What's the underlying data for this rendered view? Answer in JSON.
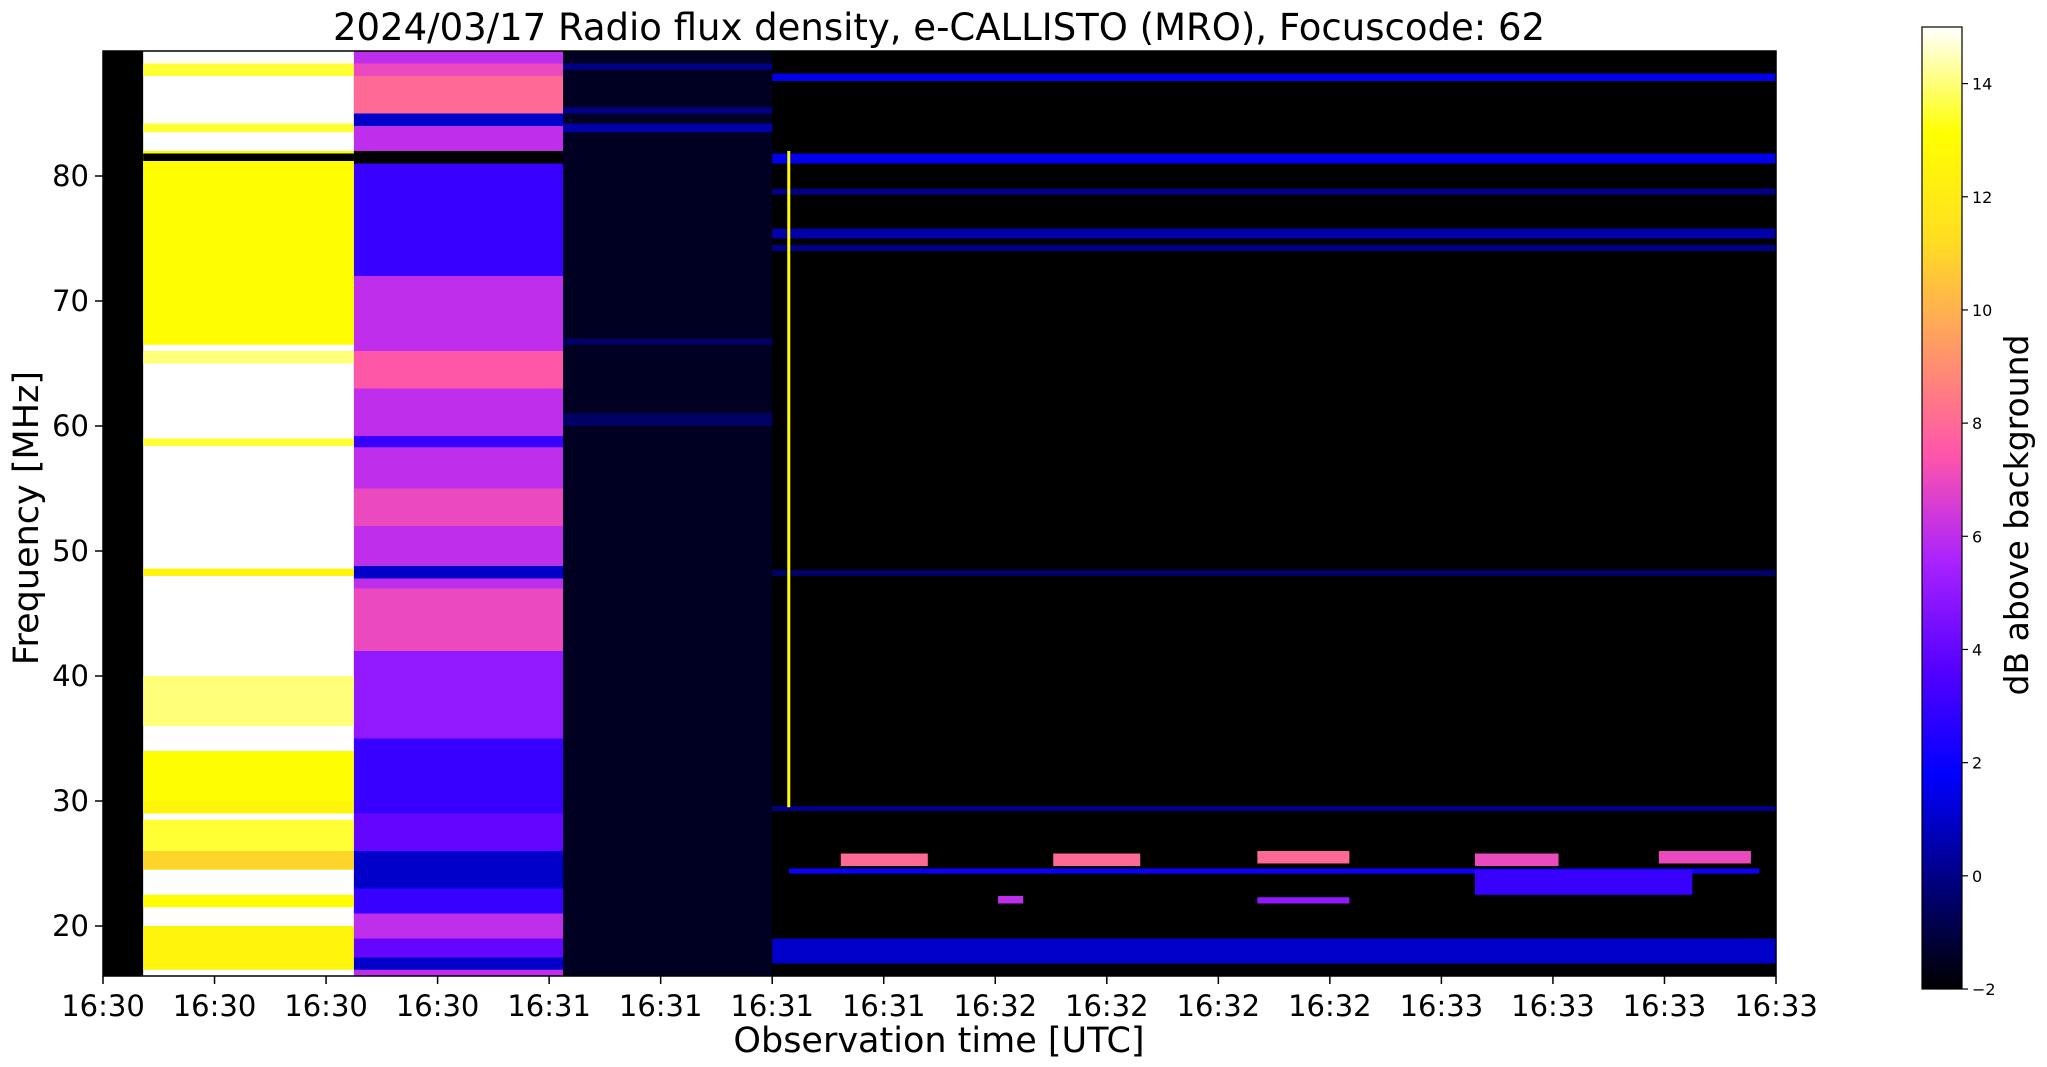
{
  "chart_data": {
    "type": "heatmap",
    "title": "2024/03/17  Radio flux density, e-CALLISTO (MRO), Focuscode: 62",
    "xlabel": "Observation time [UTC]",
    "ylabel": "Frequency [MHz]",
    "x_tick_labels": [
      "16:30",
      "16:30",
      "16:30",
      "16:30",
      "16:31",
      "16:31",
      "16:31",
      "16:31",
      "16:32",
      "16:32",
      "16:32",
      "16:32",
      "16:33",
      "16:33",
      "16:33",
      "16:33"
    ],
    "y_ticks": [
      20,
      30,
      40,
      50,
      60,
      70,
      80
    ],
    "ylim": [
      16,
      90
    ],
    "colorbar": {
      "label": "dB above background",
      "ticks": [
        -2,
        0,
        2,
        4,
        6,
        8,
        10,
        12,
        14
      ],
      "range": [
        -2,
        15
      ],
      "colormap": "gnuplot2",
      "stops": [
        "#000000",
        "#00007f",
        "#0000ff",
        "#5500ff",
        "#aa22ff",
        "#ff55aa",
        "#ff9966",
        "#ffdd22",
        "#ffff00",
        "#ffffff"
      ]
    },
    "time_segments": [
      {
        "start": 0.0,
        "end": 0.024,
        "level": -2
      },
      {
        "start": 0.024,
        "end": 0.15,
        "level": 15
      },
      {
        "start": 0.15,
        "end": 0.275,
        "level": 6
      },
      {
        "start": 0.275,
        "end": 0.4,
        "level": -1.5
      },
      {
        "start": 0.4,
        "end": 1.0,
        "level": -2
      }
    ],
    "bands": [
      {
        "seg": 1,
        "f0": 16.5,
        "f1": 20,
        "level": 12.5
      },
      {
        "seg": 1,
        "f0": 21.5,
        "f1": 22.5,
        "level": 13
      },
      {
        "seg": 1,
        "f0": 24.5,
        "f1": 26,
        "level": 11
      },
      {
        "seg": 1,
        "f0": 26,
        "f1": 28.5,
        "level": 13.5
      },
      {
        "seg": 1,
        "f0": 29,
        "f1": 30,
        "level": 12.5
      },
      {
        "seg": 1,
        "f0": 30,
        "f1": 34,
        "level": 13
      },
      {
        "seg": 1,
        "f0": 36,
        "f1": 40,
        "level": 14
      },
      {
        "seg": 1,
        "f0": 48,
        "f1": 48.6,
        "level": 12.5
      },
      {
        "seg": 1,
        "f0": 58.4,
        "f1": 59,
        "level": 13.5
      },
      {
        "seg": 1,
        "f0": 65,
        "f1": 66,
        "level": 14
      },
      {
        "seg": 1,
        "f0": 66.5,
        "f1": 82,
        "level": 13
      },
      {
        "seg": 1,
        "f0": 81.2,
        "f1": 81.8,
        "level": -2
      },
      {
        "seg": 1,
        "f0": 83.5,
        "f1": 84.2,
        "level": 13.5
      },
      {
        "seg": 1,
        "f0": 88,
        "f1": 89,
        "level": 13.5
      },
      {
        "seg": 2,
        "f0": 16.5,
        "f1": 17.5,
        "level": 1
      },
      {
        "seg": 2,
        "f0": 17.5,
        "f1": 19,
        "level": 4
      },
      {
        "seg": 2,
        "f0": 19,
        "f1": 21,
        "level": 6
      },
      {
        "seg": 2,
        "f0": 21,
        "f1": 23,
        "level": 3
      },
      {
        "seg": 2,
        "f0": 23,
        "f1": 26,
        "level": 1
      },
      {
        "seg": 2,
        "f0": 26,
        "f1": 29,
        "level": 4
      },
      {
        "seg": 2,
        "f0": 29,
        "f1": 35,
        "level": 3
      },
      {
        "seg": 2,
        "f0": 35,
        "f1": 42,
        "level": 5
      },
      {
        "seg": 2,
        "f0": 42,
        "f1": 47,
        "level": 7
      },
      {
        "seg": 2,
        "f0": 47.8,
        "f1": 48.8,
        "level": 1
      },
      {
        "seg": 2,
        "f0": 52,
        "f1": 55,
        "level": 7
      },
      {
        "seg": 2,
        "f0": 58.3,
        "f1": 59.2,
        "level": 3
      },
      {
        "seg": 2,
        "f0": 63,
        "f1": 66,
        "level": 7.5
      },
      {
        "seg": 2,
        "f0": 72,
        "f1": 82,
        "level": 3
      },
      {
        "seg": 2,
        "f0": 81,
        "f1": 82,
        "level": -2
      },
      {
        "seg": 2,
        "f0": 84,
        "f1": 85,
        "level": 1
      },
      {
        "seg": 2,
        "f0": 85,
        "f1": 88,
        "level": 8
      },
      {
        "seg": 2,
        "f0": 88,
        "f1": 89,
        "level": 7
      },
      {
        "seg": 3,
        "f0": 83.5,
        "f1": 84.2,
        "level": 0.5
      },
      {
        "seg": 3,
        "f0": 85,
        "f1": 85.5,
        "level": 0
      },
      {
        "seg": 3,
        "f0": 88.5,
        "f1": 89,
        "level": 0
      },
      {
        "seg": 3,
        "f0": 66.5,
        "f1": 67,
        "level": -0.5
      },
      {
        "seg": 3,
        "f0": 60,
        "f1": 61,
        "level": -0.5
      },
      {
        "seg": 4,
        "f0": 87.6,
        "f1": 88.2,
        "level": 1.5
      },
      {
        "seg": 4,
        "f0": 81,
        "f1": 81.8,
        "level": 1.5
      },
      {
        "seg": 4,
        "f0": 78.5,
        "f1": 79,
        "level": 0
      },
      {
        "seg": 4,
        "f0": 75,
        "f1": 75.8,
        "level": 0.5
      },
      {
        "seg": 4,
        "f0": 74,
        "f1": 74.5,
        "level": 0
      },
      {
        "seg": 4,
        "f0": 48,
        "f1": 48.5,
        "level": -0.5
      },
      {
        "seg": 4,
        "f0": 29.2,
        "f1": 29.6,
        "level": 0
      },
      {
        "seg": 4,
        "f0": 17,
        "f1": 19,
        "level": 1
      }
    ],
    "bursts": [
      {
        "t0": 0.441,
        "t1": 0.493,
        "f0": 24.8,
        "f1": 25.8,
        "level": 8
      },
      {
        "t0": 0.568,
        "t1": 0.62,
        "f0": 24.8,
        "f1": 25.8,
        "level": 8
      },
      {
        "t0": 0.69,
        "t1": 0.745,
        "f0": 25.0,
        "f1": 26.0,
        "level": 8
      },
      {
        "t0": 0.82,
        "t1": 0.87,
        "f0": 24.8,
        "f1": 25.8,
        "level": 7
      },
      {
        "t0": 0.93,
        "t1": 0.985,
        "f0": 25.0,
        "f1": 26.0,
        "level": 7
      },
      {
        "t0": 0.535,
        "t1": 0.55,
        "f0": 21.8,
        "f1": 22.4,
        "level": 6
      },
      {
        "t0": 0.69,
        "t1": 0.745,
        "f0": 21.8,
        "f1": 22.3,
        "level": 5
      },
      {
        "t0": 0.41,
        "t1": 0.99,
        "f0": 24.2,
        "f1": 24.6,
        "level": 2
      },
      {
        "t0": 0.82,
        "t1": 0.95,
        "f0": 22.5,
        "f1": 24.5,
        "level": 3
      }
    ],
    "spike": {
      "t": 0.409,
      "f0": 29.5,
      "f1": 82,
      "level": 13
    }
  }
}
